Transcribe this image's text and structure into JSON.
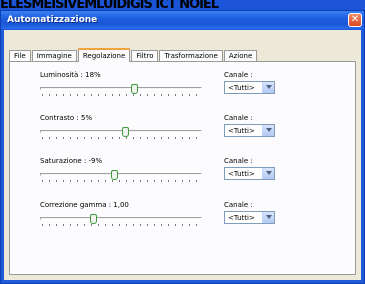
{
  "background": {
    "text": "ELESMEISIVEMLUIDIGIS ICT NOIEL"
  },
  "window": {
    "title": "Automatizzazione",
    "close_icon": "close-icon",
    "title_color": "#ffffff",
    "titlebar_color": "#1d5fdf"
  },
  "tabs": [
    {
      "label": "File"
    },
    {
      "label": "Immagine"
    },
    {
      "label": "Regolazione",
      "active": true
    },
    {
      "label": "Filtro"
    },
    {
      "label": "Trasformazione"
    },
    {
      "label": "Azione"
    }
  ],
  "adjustments": [
    {
      "label": "Luminosità : 18%",
      "value_fraction": 0.59,
      "channel_label": "Canale :",
      "channel_value": "<Tutti>"
    },
    {
      "label": "Contrasto : 5%",
      "value_fraction": 0.53,
      "channel_label": "Canale :",
      "channel_value": "<Tutti>"
    },
    {
      "label": "Saturazione : -9%",
      "value_fraction": 0.46,
      "channel_label": "Canale :",
      "channel_value": "<Tutti>"
    },
    {
      "label": "Correzione gamma : 1,00",
      "value_fraction": 0.32,
      "channel_label": "Canale :",
      "channel_value": "<Tutti>"
    }
  ]
}
